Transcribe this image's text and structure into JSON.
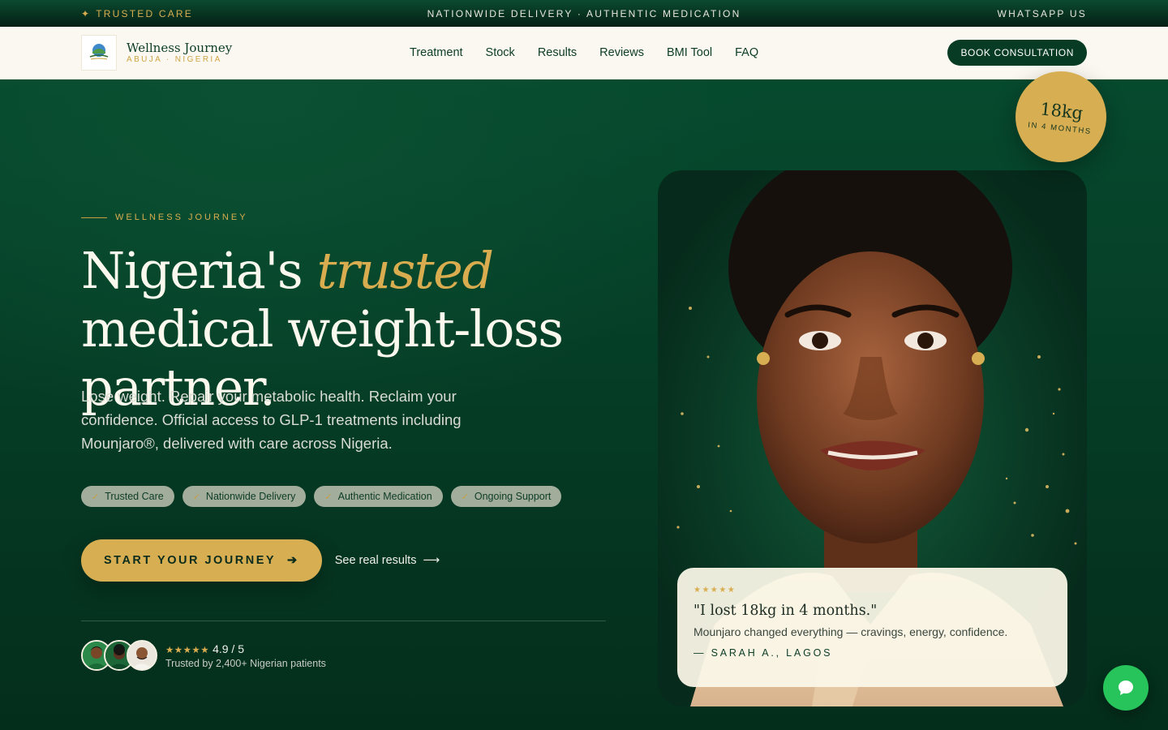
{
  "topbar": {
    "left": "TRUSTED CARE",
    "center": "NATIONWIDE DELIVERY · AUTHENTIC MEDICATION",
    "right": "WHATSAPP US"
  },
  "brand": {
    "name": "Wellness Journey",
    "location": "ABUJA · NIGERIA"
  },
  "nav": {
    "items": [
      "Treatment",
      "Stock",
      "Results",
      "Reviews",
      "BMI Tool",
      "FAQ"
    ],
    "cta": "BOOK CONSULTATION"
  },
  "hero": {
    "eyebrow": "WELLNESS JOURNEY",
    "headline_pre": "Nigeria's ",
    "headline_accent": "trusted",
    "headline_post": " medical weight-loss partner.",
    "lede": "Lose weight. Repair your metabolic health. Reclaim your confidence. Official access to GLP-1 treatments including Mounjaro®, delivered with care across Nigeria.",
    "chips": [
      "Trusted Care",
      "Nationwide Delivery",
      "Authentic Medication",
      "Ongoing Support"
    ],
    "cta_primary": "START YOUR JOURNEY",
    "cta_secondary": "See real results",
    "rating_stars": "★★★★★",
    "rating_value": "4.9 / 5",
    "trust_text": "Trusted by 2,400+ Nigerian patients"
  },
  "badge": {
    "value": "18kg",
    "caption": "IN 4 MONTHS"
  },
  "testimonial": {
    "stars": "★★★★★",
    "quote": "\"I lost 18kg in 4 months.\"",
    "body": "Mounjaro changed everything — cravings, energy, confidence.",
    "author": "— SARAH A., LAGOS"
  },
  "colors": {
    "brand_green": "#073b24",
    "gold": "#d8ae52",
    "whatsapp": "#27c45c",
    "cream": "#faf8f0"
  },
  "icons": {
    "chat": "chat-bubble-icon",
    "arrow": "arrow-right-icon",
    "check": "check-icon",
    "sparkle": "sparkle-icon"
  }
}
